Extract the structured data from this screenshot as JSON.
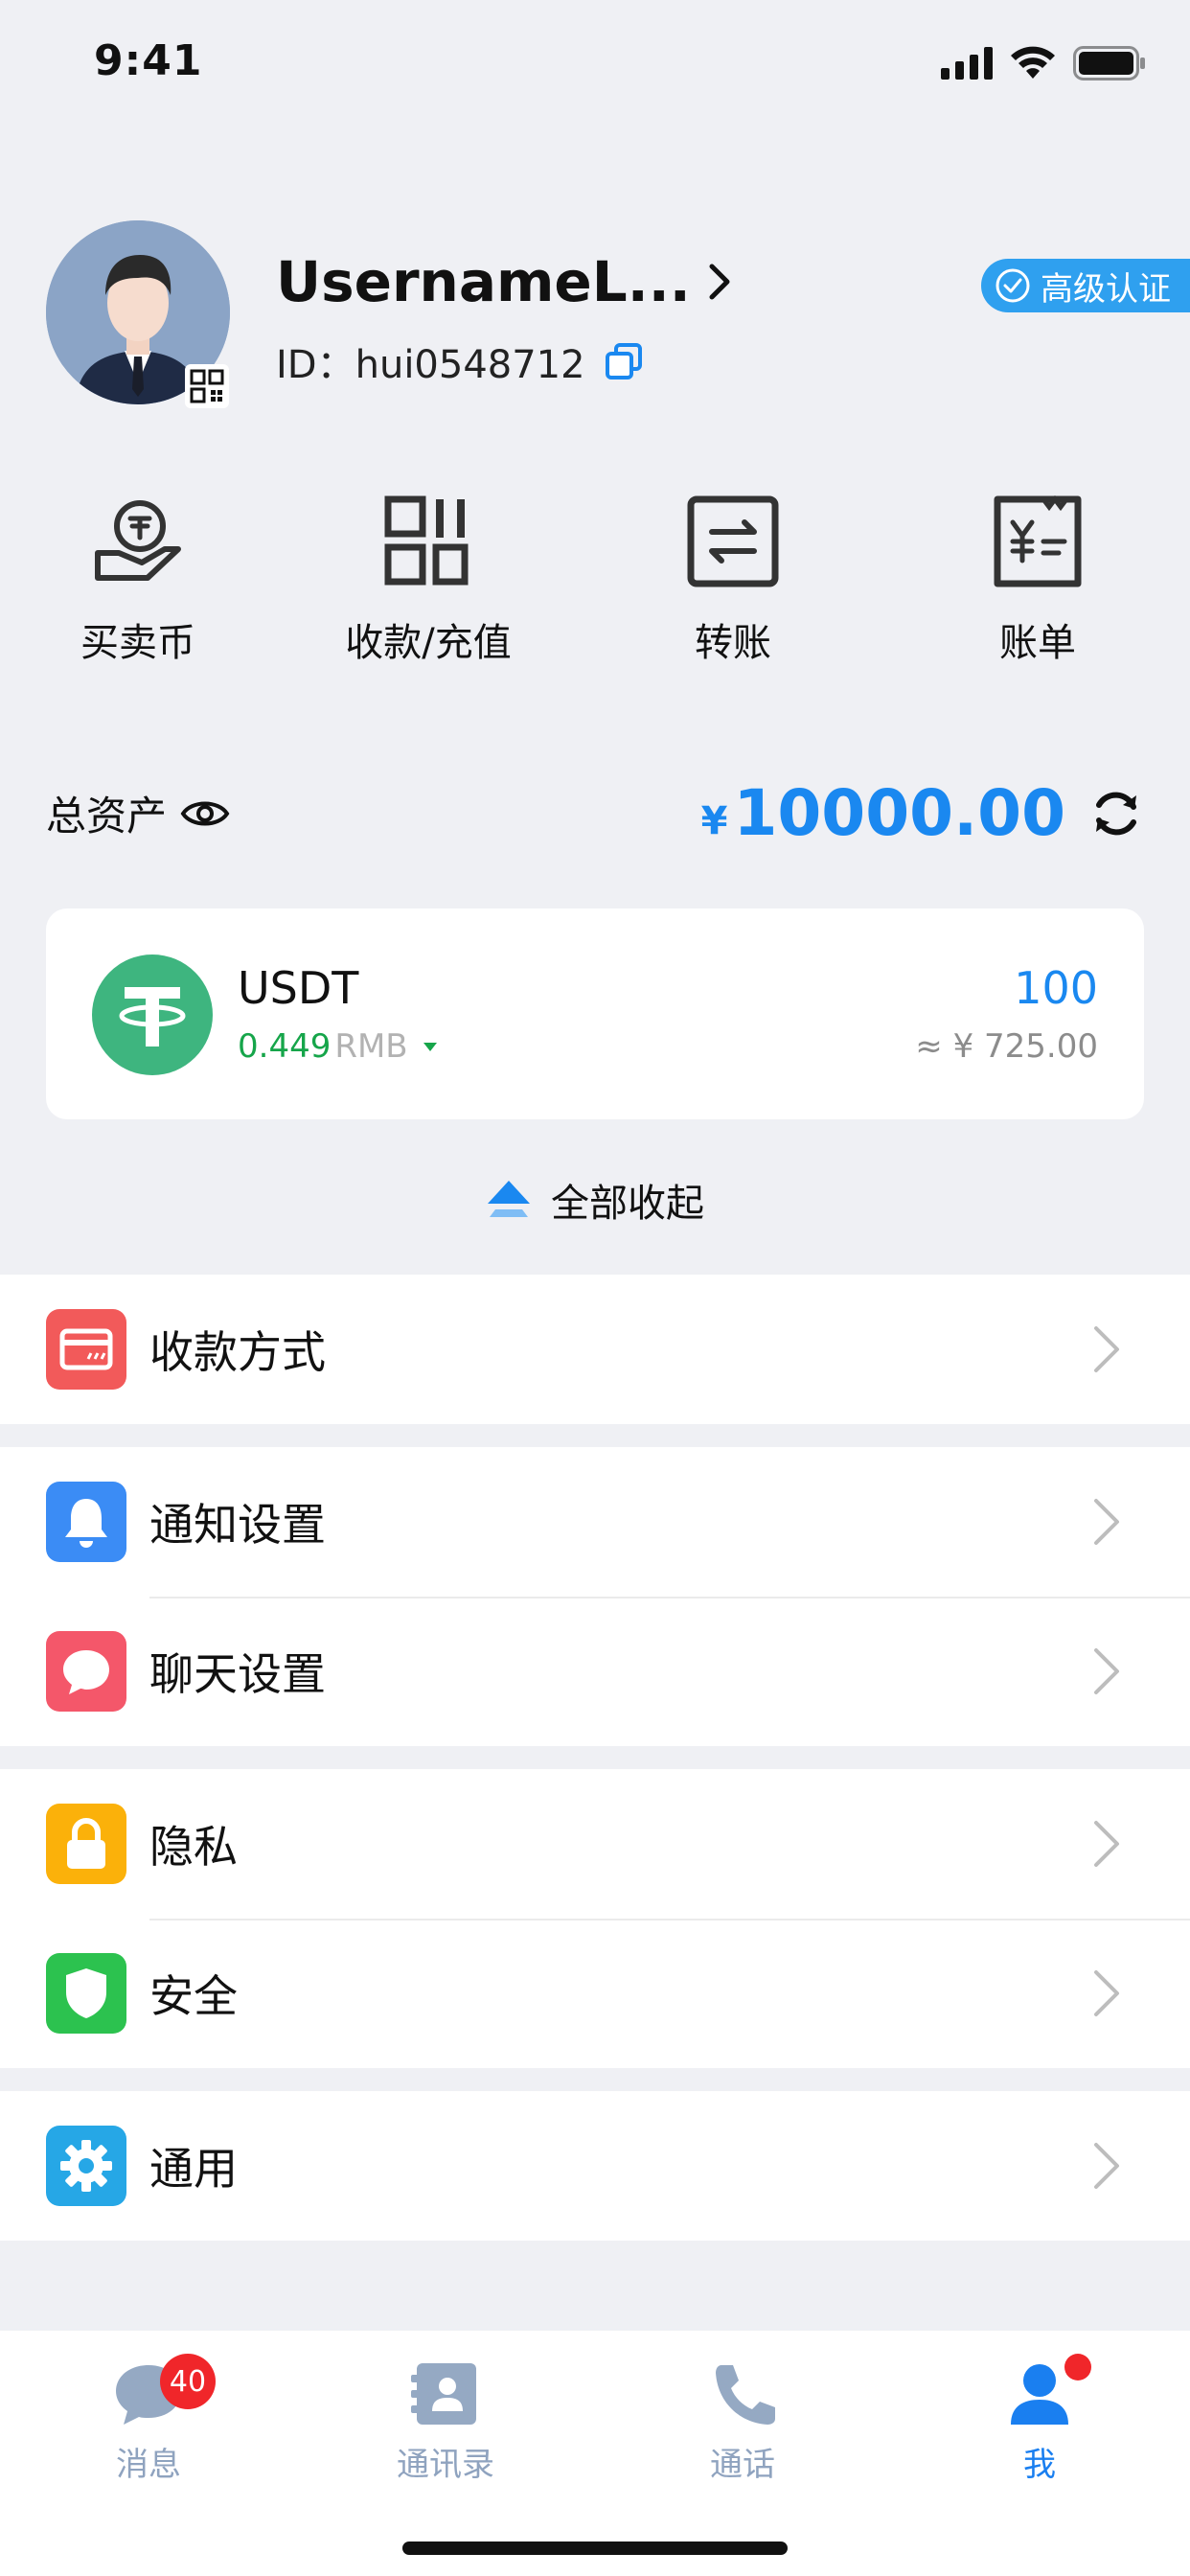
{
  "status_bar": {
    "time": "9:41"
  },
  "profile": {
    "username": "UsernameL...",
    "id_label": "ID：",
    "id_value": "hui0548712",
    "certification": "高级认证"
  },
  "quick_actions": [
    {
      "label": "买卖币",
      "icon": "hand-coin-icon"
    },
    {
      "label": "收款/充值",
      "icon": "qr-code-icon"
    },
    {
      "label": "转账",
      "icon": "transfer-icon"
    },
    {
      "label": "账单",
      "icon": "bill-icon"
    }
  ],
  "assets": {
    "label": "总资产",
    "currency": "¥",
    "amount": "10000.00"
  },
  "coin": {
    "name": "USDT",
    "price": "0.449",
    "price_unit": "RMB",
    "amount": "100",
    "approx_value": "≈ ¥ 725.00"
  },
  "collapse_label": "全部收起",
  "menu": {
    "payment_methods": "收款方式",
    "notification_settings": "通知设置",
    "chat_settings": "聊天设置",
    "privacy": "隐私",
    "security": "安全",
    "general": "通用"
  },
  "colors": {
    "accent": "#1a88f0",
    "payment_icon": "#f25a5a",
    "notification_icon": "#3b8cf5",
    "chat_icon": "#f4576a",
    "privacy_icon": "#fbb10a",
    "security_icon": "#2cc24f",
    "general_icon": "#26a7e6"
  },
  "tab_bar": {
    "messages": "消息",
    "messages_badge": "40",
    "contacts": "通讯录",
    "calls": "通话",
    "me": "我"
  }
}
